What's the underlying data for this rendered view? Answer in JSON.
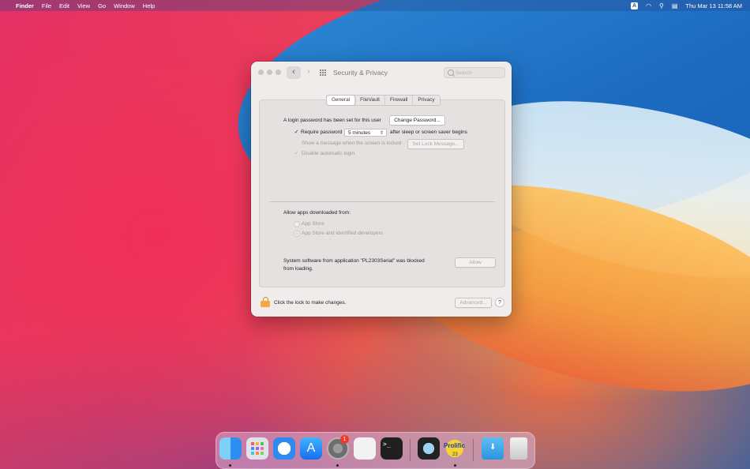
{
  "menubar": {
    "app_name": "Finder",
    "items": [
      "File",
      "Edit",
      "View",
      "Go",
      "Window",
      "Help"
    ],
    "input_source": "A",
    "clock": "Thu Mar 13  11:58 AM"
  },
  "window": {
    "title": "Security & Privacy",
    "search_placeholder": "Search",
    "tabs": [
      "General",
      "FileVault",
      "Firewall",
      "Privacy"
    ],
    "active_tab": "General",
    "general": {
      "login_password_text": "A login password has been set for this user",
      "change_password_button": "Change Password...",
      "require_password_label": "Require password",
      "require_password_checked": true,
      "require_password_delay": "5 minutes",
      "after_sleep_text": "after sleep or screen saver begins",
      "show_message_label": "Show a message when the screen is locked",
      "show_message_checked": false,
      "set_lock_message_button": "Set Lock Message...",
      "disable_auto_login_label": "Disable automatic login",
      "disable_auto_login_checked": true,
      "allow_apps_heading": "Allow apps downloaded from:",
      "radio_options": [
        "App Store",
        "App Store and identified developers"
      ],
      "radio_selected": "App Store and identified developers",
      "blocked_text_line1": "System software from application \"PL2303Serial\" was blocked",
      "blocked_text_line2": "from loading.",
      "allow_button": "Allow"
    },
    "footer": {
      "lock_text": "Click the lock to make changes.",
      "advanced_button": "Advanced...",
      "help_label": "?"
    }
  },
  "dock": {
    "apps": [
      "Finder",
      "Launchpad",
      "Safari",
      "App Store",
      "System Preferences",
      "Printer",
      "Terminal",
      "QuickTime Player",
      "Prolific",
      "Downloads",
      "Trash"
    ],
    "system_prefs_badge": "1",
    "prolific_label": "Prolific",
    "prolific_sub": "23"
  },
  "colors": {
    "accent_blue": "#1a63b5",
    "badge_red": "#f03a2e",
    "lock_orange": "#f3a93c"
  }
}
